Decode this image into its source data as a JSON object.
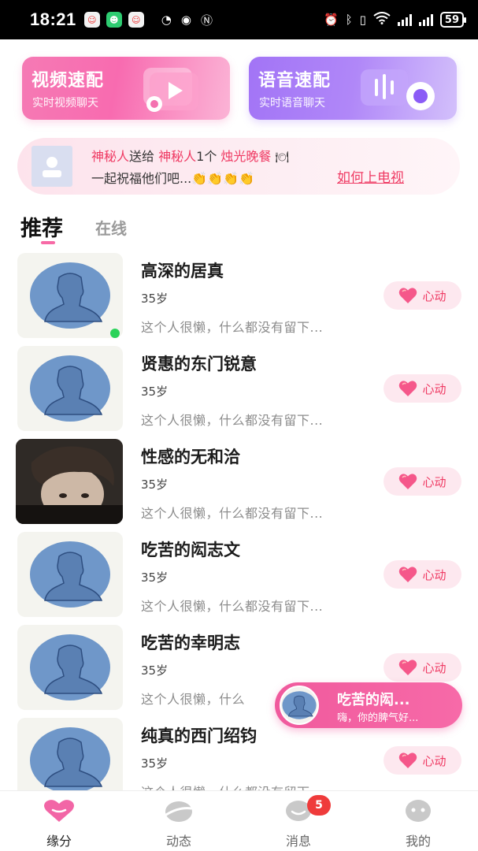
{
  "status_bar": {
    "time": "18:21",
    "battery": "59"
  },
  "quick_match": {
    "video": {
      "title": "视频速配",
      "subtitle": "实时视频聊天"
    },
    "voice": {
      "title": "语音速配",
      "subtitle": "实时语音聊天"
    }
  },
  "gift_banner": {
    "sender": "神秘人",
    "verb": "送给",
    "receiver": "神秘人",
    "count": "1个",
    "gift": "烛光晚餐",
    "line2": "一起祝福他们吧...👏👏👏👏",
    "link": "如何上电视"
  },
  "tabs": {
    "recommend": "推荐",
    "online": "在线"
  },
  "users": [
    {
      "name": "高深的居真",
      "age": "35岁",
      "bio": "这个人很懒，什么都没有留下...",
      "button": "心动",
      "online": true
    },
    {
      "name": "贤惠的东门锐意",
      "age": "35岁",
      "bio": "这个人很懒，什么都没有留下...",
      "button": "心动"
    },
    {
      "name": "性感的无和洽",
      "age": "35岁",
      "bio": "这个人很懒，什么都没有留下...",
      "button": "心动",
      "photo": true
    },
    {
      "name": "吃苦的闳志文",
      "age": "35岁",
      "bio": "这个人很懒，什么都没有留下...",
      "button": "心动"
    },
    {
      "name": "吃苦的幸明志",
      "age": "35岁",
      "bio": "这个人很懒，什么",
      "button": "心动"
    },
    {
      "name": "纯真的西门绍钧",
      "age": "35岁",
      "bio": "这个人很懒，什么都没有留下...",
      "button": "心动"
    }
  ],
  "floating_chat": {
    "name": "吃苦的闳...",
    "message": "嗨，你的脾气好..."
  },
  "bottom_nav": {
    "items": [
      {
        "label": "缘分",
        "icon": "heart-icon"
      },
      {
        "label": "动态",
        "icon": "planet-icon"
      },
      {
        "label": "消息",
        "icon": "chat-bubble-icon"
      },
      {
        "label": "我的",
        "icon": "face-icon"
      }
    ],
    "message_badge": "5"
  },
  "colors": {
    "accent_pink": "#ef3a63",
    "video_card": "#f57ab4",
    "voice_card": "#a274f6",
    "online_green": "#2bd35a"
  }
}
